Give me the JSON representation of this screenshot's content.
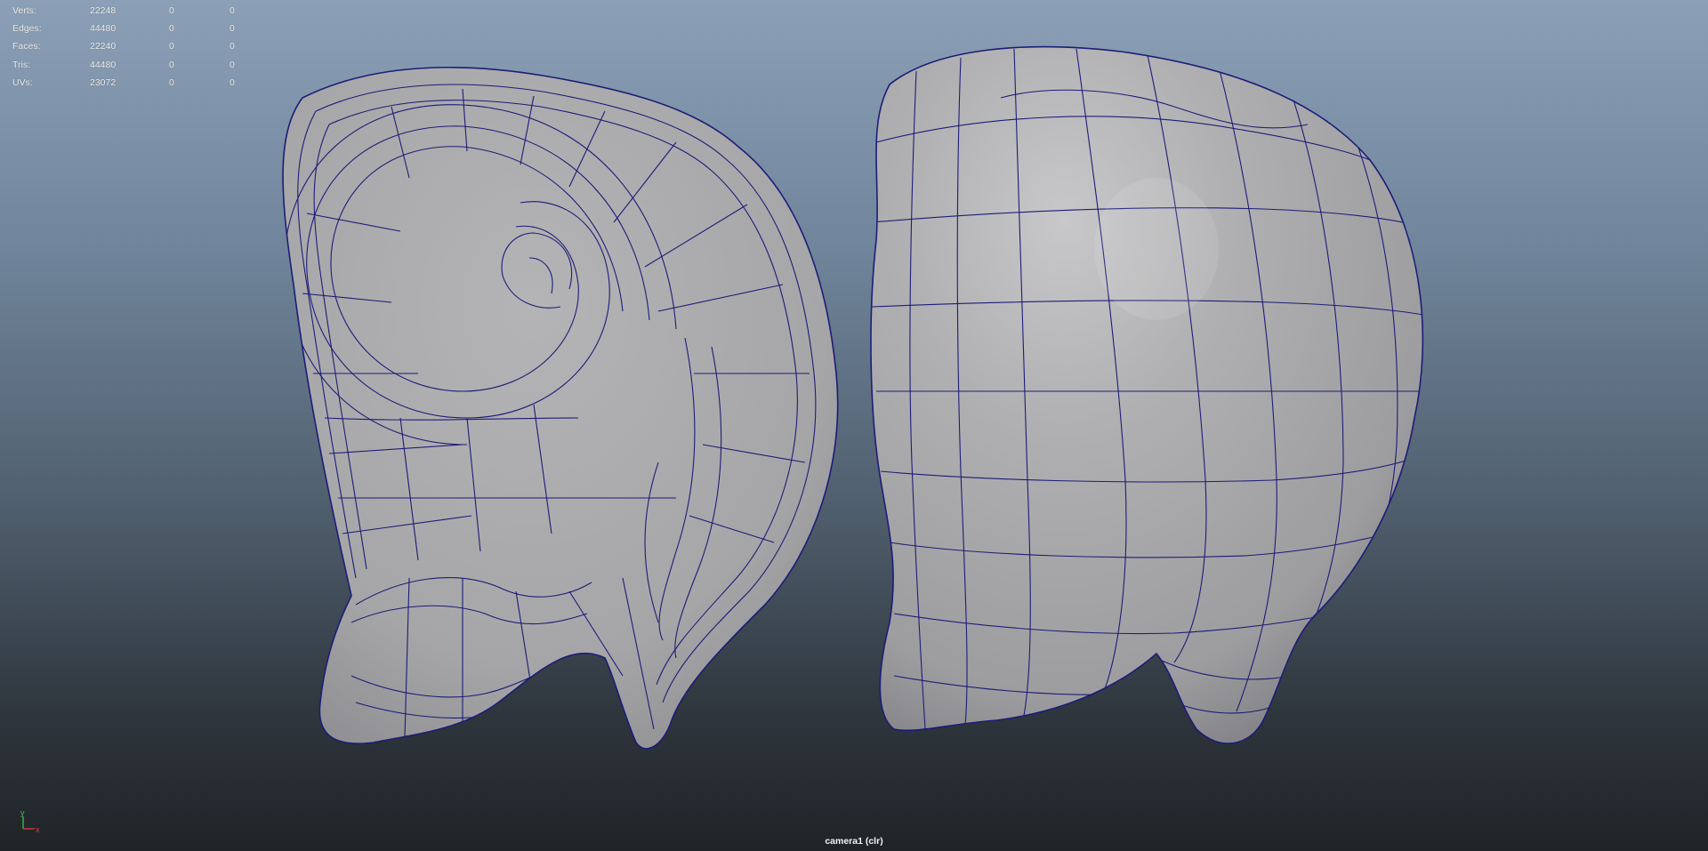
{
  "hud": {
    "rows": [
      {
        "label": "Verts:",
        "total": "22248",
        "selected": "0",
        "selected2": "0"
      },
      {
        "label": "Edges:",
        "total": "44480",
        "selected": "0",
        "selected2": "0"
      },
      {
        "label": "Faces:",
        "total": "22240",
        "selected": "0",
        "selected2": "0"
      },
      {
        "label": "Tris:",
        "total": "44480",
        "selected": "0",
        "selected2": "0"
      },
      {
        "label": "UVs:",
        "total": "23072",
        "selected": "0",
        "selected2": "0"
      }
    ]
  },
  "viewport": {
    "camera_label": "camera1 (clr)",
    "axis": {
      "y_label": "y",
      "x_label": "x",
      "y_color": "#34c84a",
      "x_color": "#e33b3b"
    },
    "wire_color": "#1c1c78",
    "mesh_fill": "#a9a9ab",
    "objects": [
      "ear-mesh-front",
      "ear-mesh-back"
    ]
  }
}
